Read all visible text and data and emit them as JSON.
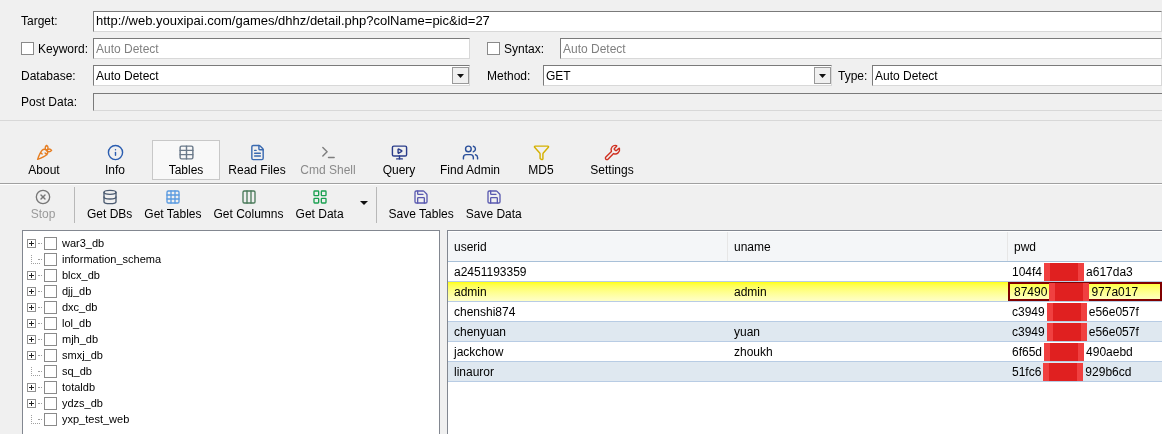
{
  "form": {
    "target": {
      "label": "Target:",
      "value": "http://web.youxipai.com/games/dhhz/detail.php?colName=pic&id=27"
    },
    "keyword": {
      "label": "Keyword:",
      "checked": false,
      "placeholder": "Auto Detect"
    },
    "syntax": {
      "label": "Syntax:",
      "checked": false,
      "placeholder": "Auto Detect"
    },
    "database": {
      "label": "Database:",
      "value": "Auto Detect"
    },
    "method": {
      "label": "Method:",
      "value": "GET"
    },
    "type": {
      "label": "Type:",
      "value": "Auto Detect"
    },
    "post_data": {
      "label": "Post Data:",
      "disabled": true
    }
  },
  "tabs": [
    {
      "label": "About",
      "selected": false,
      "disabled": false
    },
    {
      "label": "Info",
      "selected": false,
      "disabled": false
    },
    {
      "label": "Tables",
      "selected": true,
      "disabled": false
    },
    {
      "label": "Read Files",
      "selected": false,
      "disabled": false
    },
    {
      "label": "Cmd Shell",
      "selected": false,
      "disabled": true
    },
    {
      "label": "Query",
      "selected": false,
      "disabled": false
    },
    {
      "label": "Find Admin",
      "selected": false,
      "disabled": false
    },
    {
      "label": "MD5",
      "selected": false,
      "disabled": false
    },
    {
      "label": "Settings",
      "selected": false,
      "disabled": false
    }
  ],
  "action_groups": [
    [
      {
        "label": "Stop",
        "disabled": true,
        "has_menu": false
      }
    ],
    [
      {
        "label": "Get DBs",
        "disabled": false,
        "has_menu": false
      },
      {
        "label": "Get Tables",
        "disabled": false,
        "has_menu": false
      },
      {
        "label": "Get Columns",
        "disabled": false,
        "has_menu": false
      },
      {
        "label": "Get Data",
        "disabled": false,
        "has_menu": true
      }
    ],
    [
      {
        "label": "Save Tables",
        "disabled": false,
        "has_menu": false
      },
      {
        "label": "Save Data",
        "disabled": false,
        "has_menu": false
      }
    ]
  ],
  "databases": [
    {
      "name": "war3_db",
      "expandable": true,
      "checked": false
    },
    {
      "name": "information_schema",
      "expandable": false,
      "checked": false
    },
    {
      "name": "blcx_db",
      "expandable": true,
      "checked": false
    },
    {
      "name": "djj_db",
      "expandable": true,
      "checked": false
    },
    {
      "name": "dxc_db",
      "expandable": true,
      "checked": false
    },
    {
      "name": "lol_db",
      "expandable": true,
      "checked": false
    },
    {
      "name": "mjh_db",
      "expandable": true,
      "checked": false
    },
    {
      "name": "smxj_db",
      "expandable": true,
      "checked": false
    },
    {
      "name": "sq_db",
      "expandable": false,
      "checked": false
    },
    {
      "name": "totaldb",
      "expandable": true,
      "checked": false
    },
    {
      "name": "ydzs_db",
      "expandable": true,
      "checked": false
    },
    {
      "name": "yxp_test_web",
      "expandable": false,
      "checked": false
    }
  ],
  "table": {
    "columns": [
      "userid",
      "uname",
      "pwd"
    ],
    "rows": [
      {
        "userid": "a2451193359",
        "pwd_start": "104f4",
        "pwd_end": "a617da3",
        "selected": false
      },
      {
        "userid": "admin",
        "uname": "admin",
        "pwd_start": "87490",
        "pwd_end": "977a017",
        "selected": true
      },
      {
        "userid": "chenshi874",
        "pwd_start": "c3949",
        "pwd_end": "e56e057f",
        "selected": false
      },
      {
        "userid": "chenyuan",
        "uname": "yuan",
        "pwd_start": "c3949",
        "pwd_end": "e56e057f",
        "selected": false
      },
      {
        "userid": "jackchow",
        "uname": "zhoukh",
        "pwd_start": "6f65d",
        "pwd_end": "490aebd",
        "selected": false
      },
      {
        "userid": "linauror",
        "pwd_start": "51fc6",
        "pwd_end": "929b6cd",
        "selected": false
      }
    ]
  }
}
